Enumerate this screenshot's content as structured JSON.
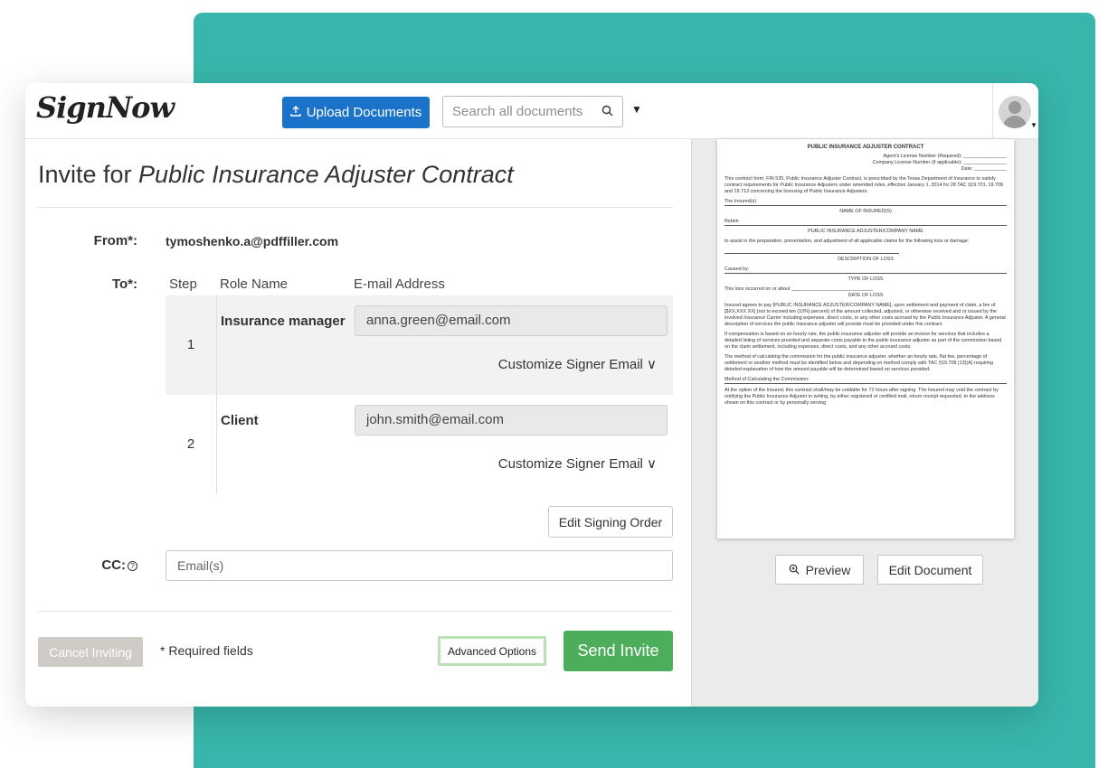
{
  "app": {
    "logo": "SignNow"
  },
  "topbar": {
    "upload_label": "Upload Documents",
    "upload_icon": "upload-icon",
    "search_placeholder": "Search all documents",
    "search_icon": "search-icon"
  },
  "invite": {
    "title_prefix": "Invite for ",
    "title_doc": "Public Insurance Adjuster Contract",
    "from_label": "From*:",
    "from_value": "tymoshenko.a@pdffiller.com",
    "to_label": "To*:",
    "columns": {
      "step": "Step",
      "role": "Role Name",
      "email": "E-mail Address"
    },
    "signers": [
      {
        "step": "1",
        "role": "Insurance manager",
        "email": "anna.green@email.com",
        "customize": "Customize Signer Email ∨"
      },
      {
        "step": "2",
        "role": "Client",
        "email": "john.smith@email.com",
        "customize": "Customize Signer Email ∨"
      }
    ],
    "edit_order_label": "Edit Signing Order",
    "cc_label": "CC:",
    "cc_help_icon": "help-circle-icon",
    "cc_placeholder": "Email(s)",
    "cancel_label": "Cancel Inviting",
    "required_note": "* Required fields",
    "advanced_label": "Advanced Options",
    "send_label": "Send Invite"
  },
  "document": {
    "title": "PUBLIC INSURANCE ADJUSTER CONTRACT",
    "agent_license": "Agent's License Number (Required): ________________",
    "company_license": "Company License Number (if applicable): ________________",
    "date": "Date: ____________",
    "para1": "This contract form; FIN 535, Public Insurance Adjuster Contract, is prescribed by the Texas Department of Insurance to satisfy contract requirements for Public Insurance Adjusters under amended rules, effective January 1, 2014 for 28 TAC §19.701, 19.708 and 19.713 concerning the licensing of Public Insurance Adjusters.",
    "insured": "The Insured(s)",
    "name_of_insured": "NAME OF INSURED(S)",
    "retain": "Retain",
    "adjuster_company": "PUBLIC INSURANCE ADJUSTER/COMPANY NAME",
    "assist": "to assist in the preparation, presentation, and adjustment of all applicable claims for the following loss or damage:",
    "description_of_loss": "DESCRIPTION OF LOSS",
    "caused_by": "Caused by:",
    "type_of_loss": "TYPE OF LOSS",
    "occurred": "This loss occurred on or about ______________________________",
    "date_of_loss": "DATE OF LOSS",
    "para2": "Insured agrees to pay [PUBLIC INSURANCE ADJUSTER/COMPANY NAME], upon settlement and payment of claim, a fee of [$XX,XXX.XX] (not to exceed ten (10%) percent) of the amount collected, adjusted, or otherwise received and or issued by the involved Insurance Carrier including expenses, direct costs, or any other costs accrued by the Public Insurance Adjuster. A general description of services the public insurance adjuster will provide must be provided under this contract.",
    "para3": "If compensation is based on an hourly rate, the public insurance adjuster will provide an invoice for services that includes a detailed listing of services provided and separate costs payable to the public insurance adjuster as part of the commission based on the claim settlement, including expenses, direct costs, and any other accrued costs.",
    "para4": "The method of calculating the commission for the public insurance adjuster, whether an hourly rate, flat fee, percentage of settlement or another method must be identified below and depending on method comply with TAC §19.708 (13)(A) requiring detailed explanation of how the amount payable will be determined based on services provided.",
    "method": "Method of Calculating the Commission:",
    "para5": "At the option of the Insured, this contract shall/may be voidable for 72 hours after signing. The Insured may void the contract by notifying the Public Insurance Adjuster in writing, by either registered or certified mail, return receipt requested, to the address shown on this contract or by personally serving"
  },
  "preview_panel": {
    "preview_label": "Preview",
    "preview_icon": "zoom-in-icon",
    "edit_label": "Edit Document"
  }
}
